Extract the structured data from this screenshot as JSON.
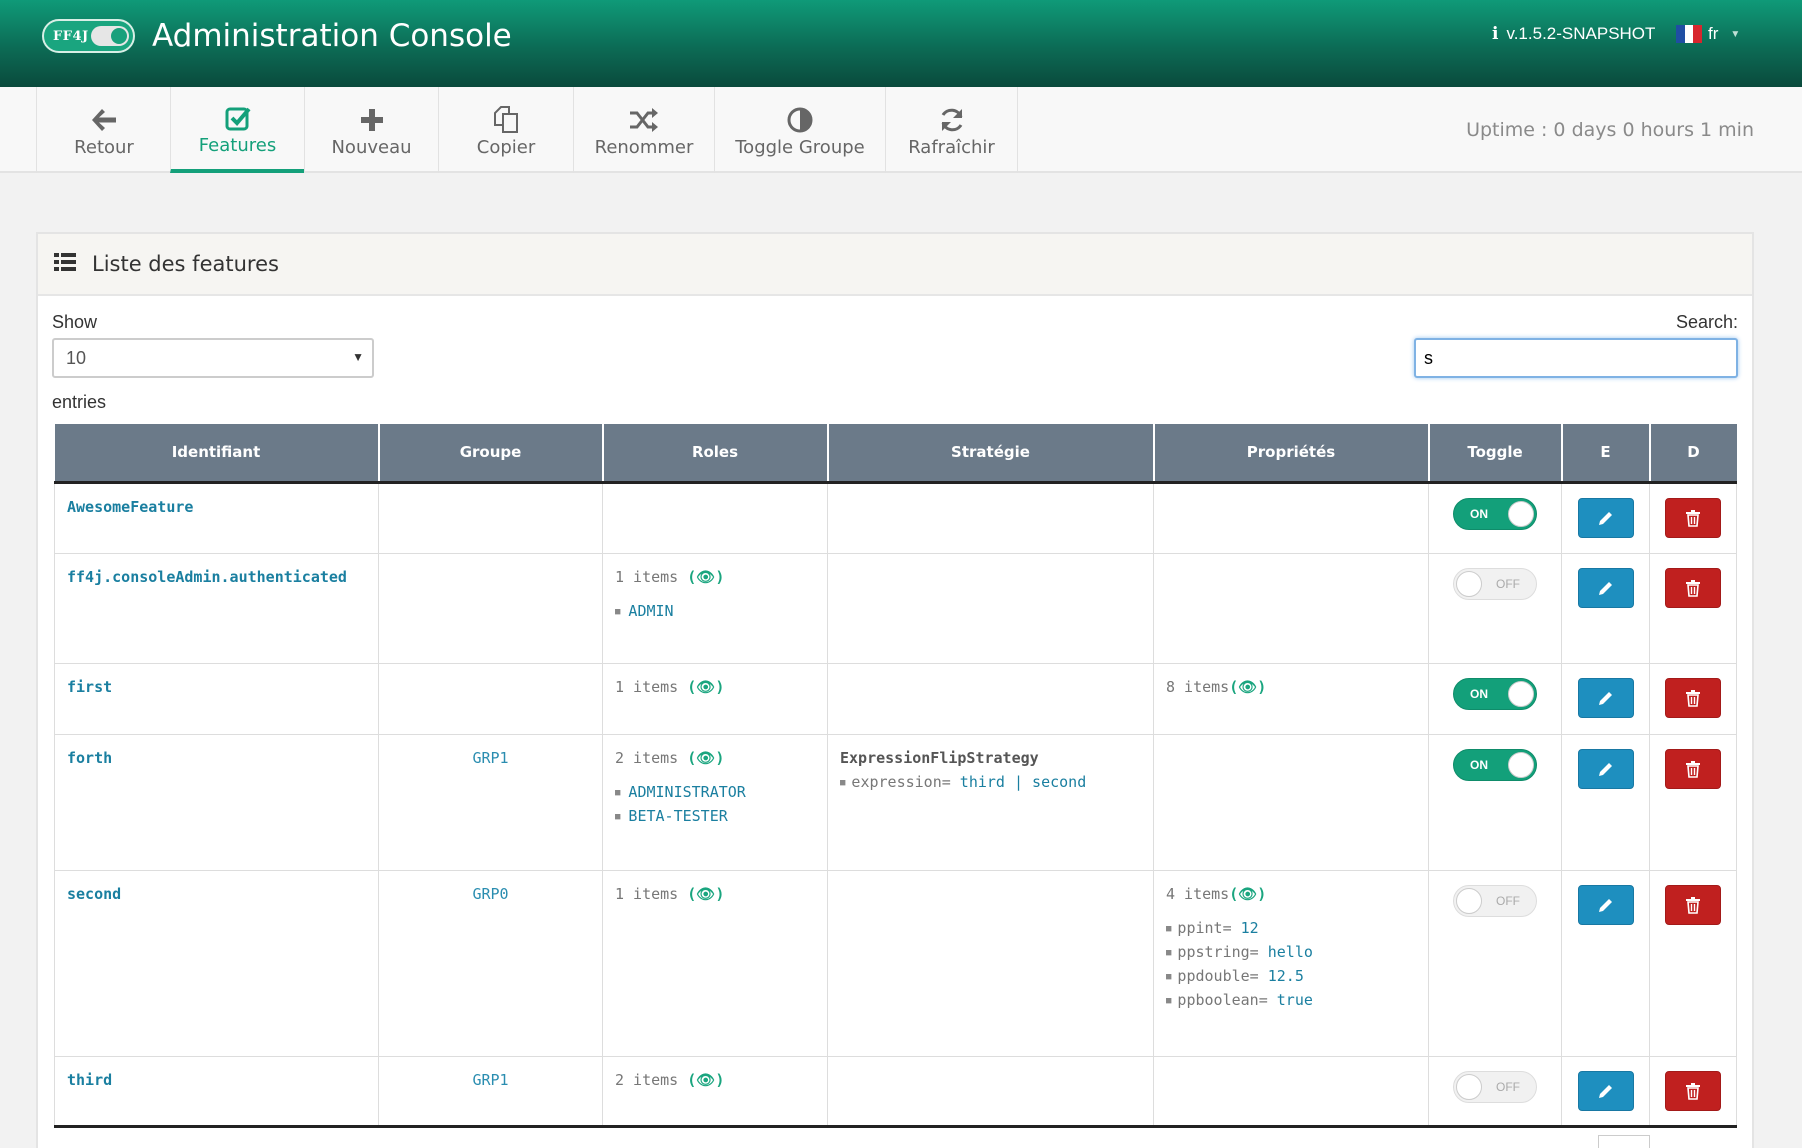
{
  "header": {
    "logo_text": "FF4J",
    "title": "Administration Console",
    "version": "v.1.5.2-SNAPSHOT",
    "language": "fr",
    "flag_colors": [
      "#1f4ea3",
      "#ffffff",
      "#d8262e"
    ]
  },
  "toolbar": {
    "items": [
      {
        "label": "Retour",
        "icon": "arrow-left-icon"
      },
      {
        "label": "Features",
        "icon": "check-square-icon",
        "active": true
      },
      {
        "label": "Nouveau",
        "icon": "plus-icon"
      },
      {
        "label": "Copier",
        "icon": "copy-icon"
      },
      {
        "label": "Renommer",
        "icon": "shuffle-icon"
      },
      {
        "label": "Toggle Groupe",
        "icon": "contrast-icon"
      },
      {
        "label": "Rafraîchir",
        "icon": "refresh-icon"
      }
    ],
    "uptime": "Uptime : 0 days 0 hours 1 min"
  },
  "panel": {
    "title": "Liste des features",
    "show_label": "Show",
    "show_value": "10",
    "entries_label": "entries",
    "search_label": "Search:",
    "search_value": "s"
  },
  "table": {
    "headers": [
      "Identifiant",
      "Groupe",
      "Roles",
      "Stratégie",
      "Propriétés",
      "Toggle",
      "E",
      "D"
    ],
    "rows": [
      {
        "id": "AwesomeFeature",
        "group": "",
        "roles_count": "",
        "roles": [],
        "strategy": "",
        "strategy_param": "",
        "props_count": "",
        "props": [],
        "toggle": "ON"
      },
      {
        "id": "ff4j.consoleAdmin.authenticated",
        "group": "",
        "roles_count": "1 items",
        "roles": [
          "ADMIN"
        ],
        "strategy": "",
        "strategy_param": "",
        "props_count": "",
        "props": [],
        "toggle": "OFF"
      },
      {
        "id": "first",
        "group": "",
        "roles_count": "1 items",
        "roles": [],
        "strategy": "",
        "strategy_param": "",
        "props_count": "8 items",
        "props": [],
        "toggle": "ON"
      },
      {
        "id": "forth",
        "group": "GRP1",
        "roles_count": "2 items",
        "roles": [
          "ADMINISTRATOR",
          "BETA-TESTER"
        ],
        "strategy": "ExpressionFlipStrategy",
        "strategy_param_key": "expression=",
        "strategy_param": "third | second",
        "props_count": "",
        "props": [],
        "toggle": "ON"
      },
      {
        "id": "second",
        "group": "GRP0",
        "roles_count": "1 items",
        "roles": [],
        "strategy": "",
        "strategy_param": "",
        "props_count": "4 items",
        "props": [
          {
            "key": "ppint=",
            "value": "12"
          },
          {
            "key": "ppstring=",
            "value": "hello"
          },
          {
            "key": "ppdouble=",
            "value": "12.5"
          },
          {
            "key": "ppboolean=",
            "value": "true"
          }
        ],
        "toggle": "OFF"
      },
      {
        "id": "third",
        "group": "GRP1",
        "roles_count": "2 items",
        "roles": [],
        "strategy": "",
        "strategy_param": "",
        "props_count": "",
        "props": [],
        "toggle": "OFF"
      }
    ]
  },
  "colors": {
    "accent": "#14a07a",
    "header_table": "#6b7a89",
    "edit_button": "#1e8fbf",
    "delete_button": "#c0201f"
  }
}
